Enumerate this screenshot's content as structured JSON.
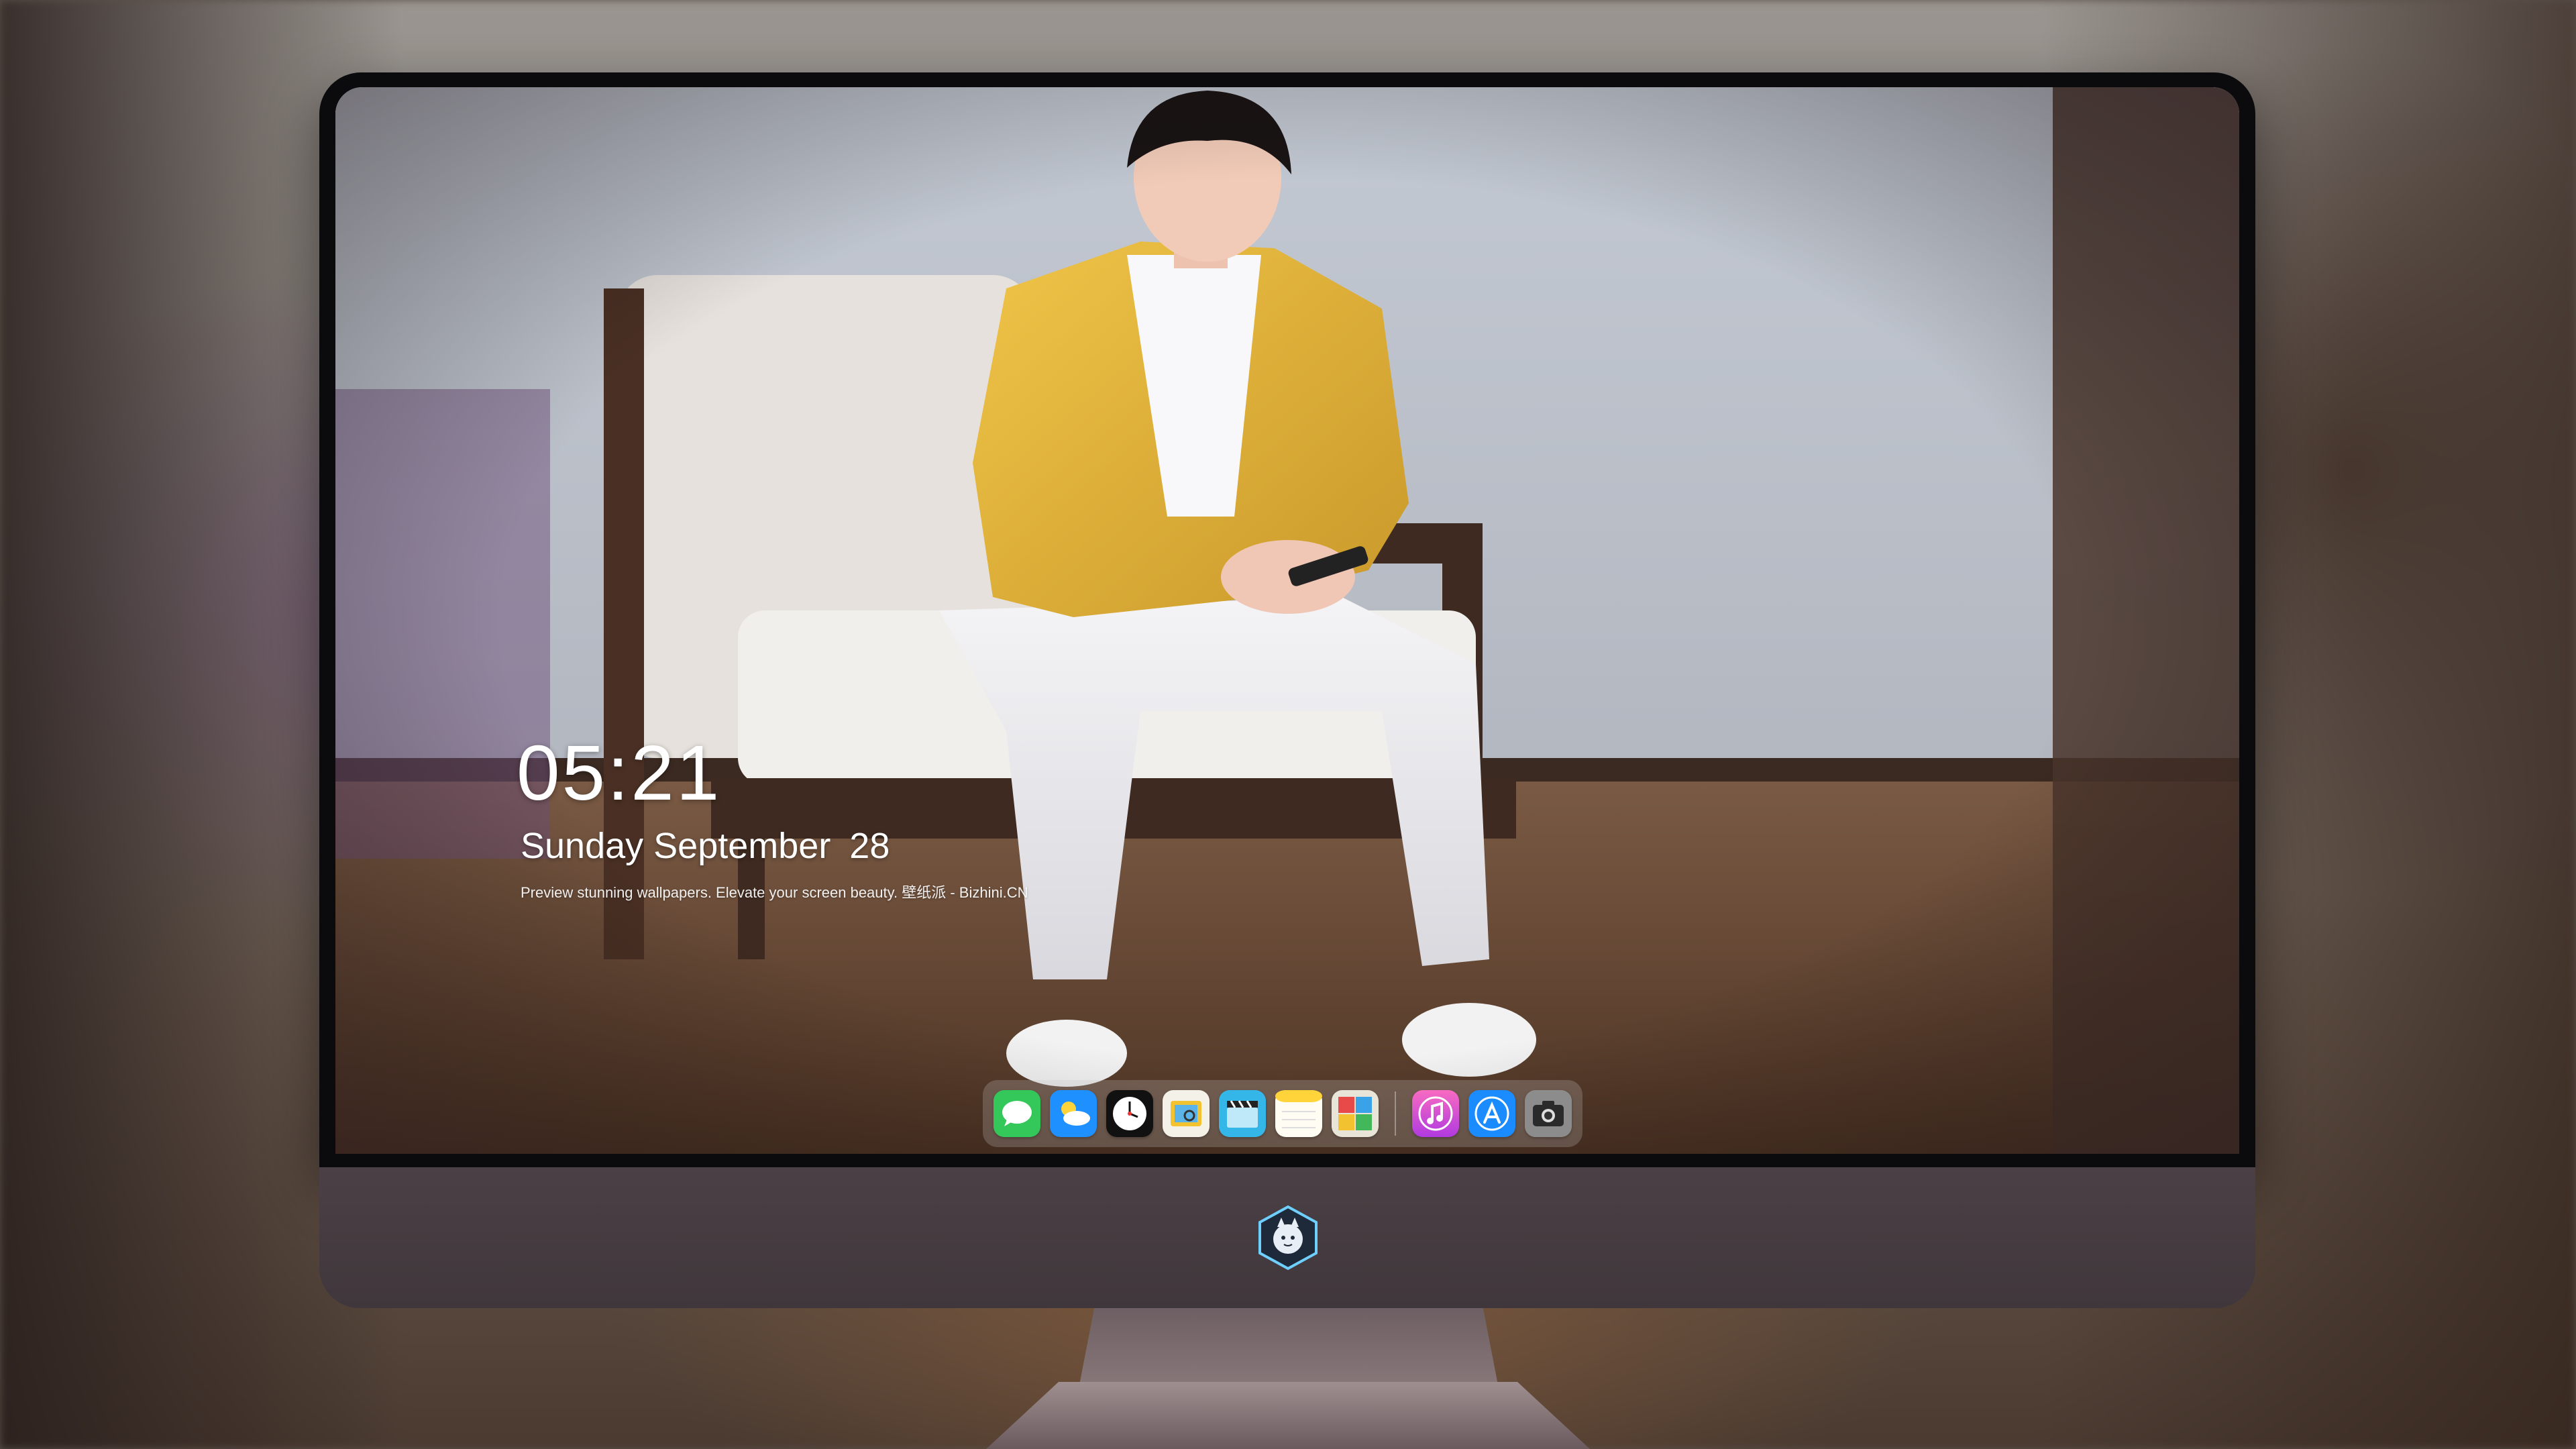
{
  "clock": {
    "time": "05:21",
    "weekday_month": "Sunday September",
    "day": "28"
  },
  "tagline": "Preview stunning wallpapers. Elevate your screen beauty. 壁纸派 - Bizhini.CN",
  "dock": {
    "apps": [
      {
        "name": "messages-icon",
        "color": "#34c759"
      },
      {
        "name": "weather-icon",
        "color": "#1e90ff"
      },
      {
        "name": "clock-icon",
        "color": "#111111"
      },
      {
        "name": "preview-icon",
        "color": "#f2c230"
      },
      {
        "name": "clips-icon",
        "color": "#35b6e8"
      },
      {
        "name": "notes-icon",
        "color": "#ffd43b"
      },
      {
        "name": "photos-grid-icon",
        "color": "#e8e4d8"
      },
      {
        "name": "music-icon",
        "color": "#f54aa4"
      },
      {
        "name": "app-store-icon",
        "color": "#1a8cff"
      },
      {
        "name": "camera-icon",
        "color": "#8c8c8c"
      }
    ]
  },
  "colors": {
    "jacket": "#e6b73c",
    "bezel": "#0b0b0d",
    "chin": "#453c41",
    "text": "#ffffff"
  }
}
